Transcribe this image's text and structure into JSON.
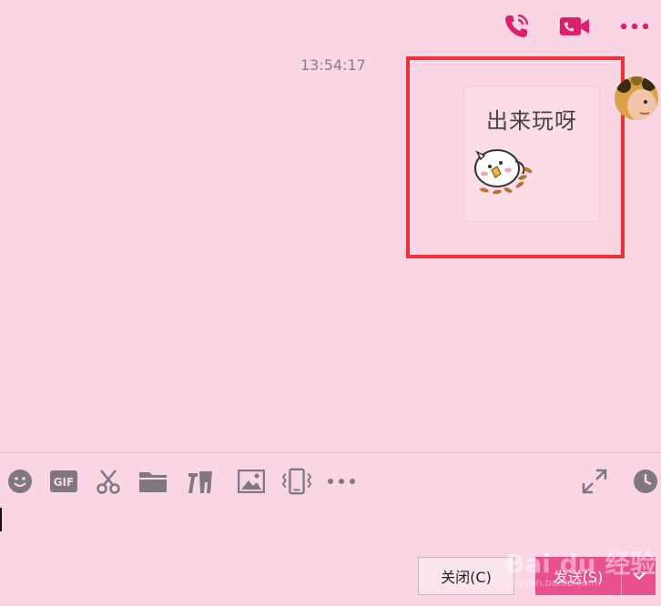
{
  "header": {
    "icons": [
      "phone-call-icon",
      "video-call-icon",
      "more-icon"
    ],
    "accent": "#d91f6e"
  },
  "chat": {
    "timestamp": "13:54:17",
    "sticker_text": "出来玩呀"
  },
  "toolbar": {
    "icons": [
      "emoji-icon",
      "gif-icon",
      "scissors-icon",
      "folder-icon",
      "font-icon",
      "image-icon",
      "shake-icon",
      "more-icon",
      "expand-icon",
      "history-icon"
    ]
  },
  "footer": {
    "close_label": "关闭(C)",
    "send_label": "发送(S)",
    "send_color": "#e8508e"
  },
  "watermark": {
    "main": "Bai du 经验",
    "sub": "jingyan.baidu.com"
  }
}
